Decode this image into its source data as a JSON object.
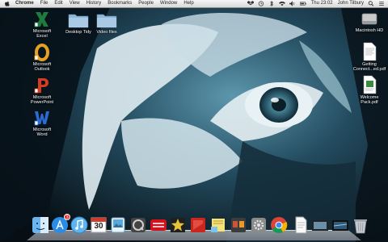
{
  "menubar": {
    "app_name": "Chrome",
    "items": [
      "File",
      "Edit",
      "View",
      "History",
      "Bookmarks",
      "People",
      "Window",
      "Help"
    ],
    "clock": "Thu 23:02",
    "user": "John Tilbury"
  },
  "desktop": {
    "left_icons": [
      {
        "label": "Microsoft\nExcel",
        "letter": "X",
        "color": "#1e7b3c"
      },
      {
        "label": "Microsoft\nOutlook",
        "letter": "O",
        "color": "#e8a020"
      },
      {
        "label": "Microsoft\nPowerPoint",
        "letter": "P",
        "color": "#d83b1e"
      },
      {
        "label": "Microsoft\nWord",
        "letter": "W",
        "color": "#2b6cd4"
      }
    ],
    "folders": [
      {
        "label": "Desktop Tidy"
      },
      {
        "label": "Video files"
      }
    ],
    "right_icons": [
      {
        "label": "Macintosh HD"
      },
      {
        "label": "Getting\nConnect...ed.pdf"
      },
      {
        "label": "Welcome\nPack.pdf"
      }
    ]
  },
  "dock": {
    "items": [
      "finder",
      "app-store",
      "itunes",
      "calendar",
      "preview",
      "quicktime",
      "podcast-app",
      "photo-app",
      "red-app",
      "stickies",
      "photo-booth",
      "preferences",
      "chrome",
      "document",
      "image-viewer",
      "screen-app",
      "trash"
    ],
    "app_store_badge": "3",
    "calendar_date": "30"
  },
  "colors": {
    "accent": "#3a6f8a",
    "menubar": "#e6e6e6"
  }
}
